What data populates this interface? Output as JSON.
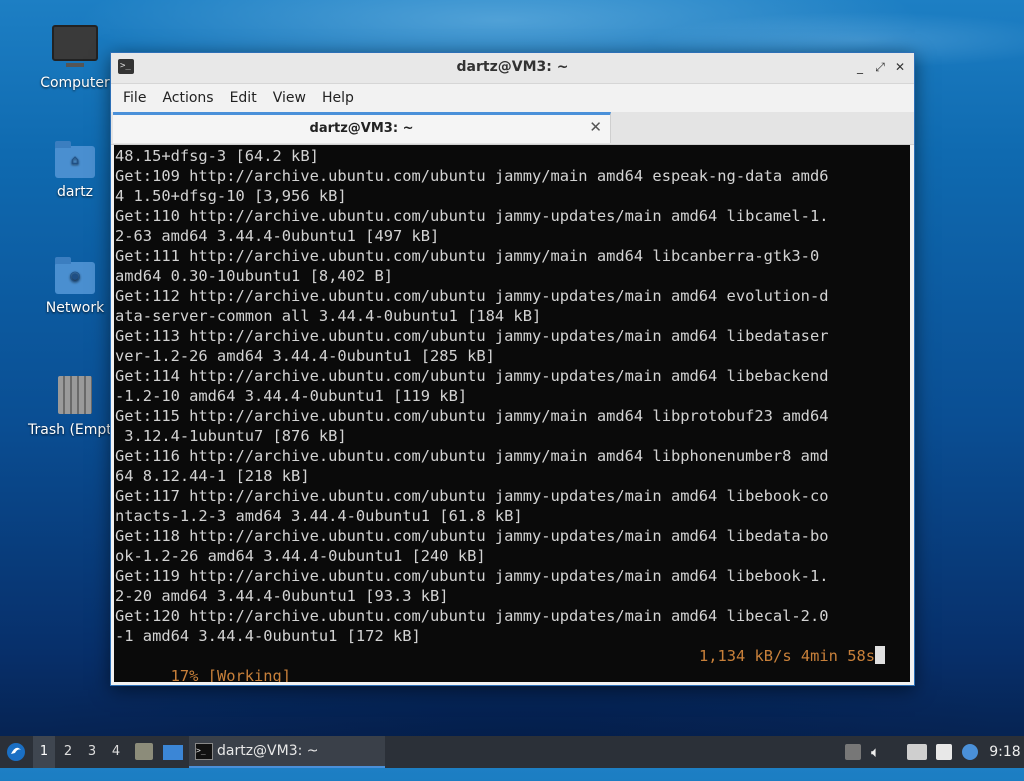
{
  "desktop": {
    "icons": [
      {
        "label": "Computer",
        "icon": "computer-icon"
      },
      {
        "label": "dartz",
        "icon": "home-folder-icon"
      },
      {
        "label": "Network",
        "icon": "network-folder-icon"
      },
      {
        "label": "Trash (Empt",
        "icon": "trash-icon"
      }
    ]
  },
  "window": {
    "title": "dartz@VM3: ~",
    "controls": {
      "minimize": "_",
      "maximize": "⤢",
      "close": "✕"
    },
    "menu": [
      "File",
      "Actions",
      "Edit",
      "View",
      "Help"
    ],
    "tab": {
      "label": "dartz@VM3: ~",
      "close": "✕"
    }
  },
  "terminal": {
    "lines": [
      "48.15+dfsg-3 [64.2 kB]",
      "Get:109 http://archive.ubuntu.com/ubuntu jammy/main amd64 espeak-ng-data amd6",
      "4 1.50+dfsg-10 [3,956 kB]",
      "Get:110 http://archive.ubuntu.com/ubuntu jammy-updates/main amd64 libcamel-1.",
      "2-63 amd64 3.44.4-0ubuntu1 [497 kB]",
      "Get:111 http://archive.ubuntu.com/ubuntu jammy/main amd64 libcanberra-gtk3-0",
      "amd64 0.30-10ubuntu1 [8,402 B]",
      "Get:112 http://archive.ubuntu.com/ubuntu jammy-updates/main amd64 evolution-d",
      "ata-server-common all 3.44.4-0ubuntu1 [184 kB]",
      "Get:113 http://archive.ubuntu.com/ubuntu jammy-updates/main amd64 libedataser",
      "ver-1.2-26 amd64 3.44.4-0ubuntu1 [285 kB]",
      "Get:114 http://archive.ubuntu.com/ubuntu jammy-updates/main amd64 libebackend",
      "-1.2-10 amd64 3.44.4-0ubuntu1 [119 kB]",
      "Get:115 http://archive.ubuntu.com/ubuntu jammy/main amd64 libprotobuf23 amd64",
      " 3.12.4-1ubuntu7 [876 kB]",
      "Get:116 http://archive.ubuntu.com/ubuntu jammy/main amd64 libphonenumber8 amd",
      "64 8.12.44-1 [218 kB]",
      "Get:117 http://archive.ubuntu.com/ubuntu jammy-updates/main amd64 libebook-co",
      "ntacts-1.2-3 amd64 3.44.4-0ubuntu1 [61.8 kB]",
      "Get:118 http://archive.ubuntu.com/ubuntu jammy-updates/main amd64 libedata-bo",
      "ok-1.2-26 amd64 3.44.4-0ubuntu1 [240 kB]",
      "Get:119 http://archive.ubuntu.com/ubuntu jammy-updates/main amd64 libebook-1.",
      "2-20 amd64 3.44.4-0ubuntu1 [93.3 kB]",
      "Get:120 http://archive.ubuntu.com/ubuntu jammy-updates/main amd64 libecal-2.0",
      "-1 amd64 3.44.4-0ubuntu1 [172 kB]"
    ],
    "status_left": "17% [Working]",
    "status_right": "1,134 kB/s 4min 58s",
    "status_color": "#c8803a"
  },
  "panel": {
    "workspaces": [
      "1",
      "2",
      "3",
      "4"
    ],
    "active_workspace": "1",
    "task_label": "dartz@VM3: ~",
    "clock": "9:18",
    "accent": "#4a90d9"
  }
}
